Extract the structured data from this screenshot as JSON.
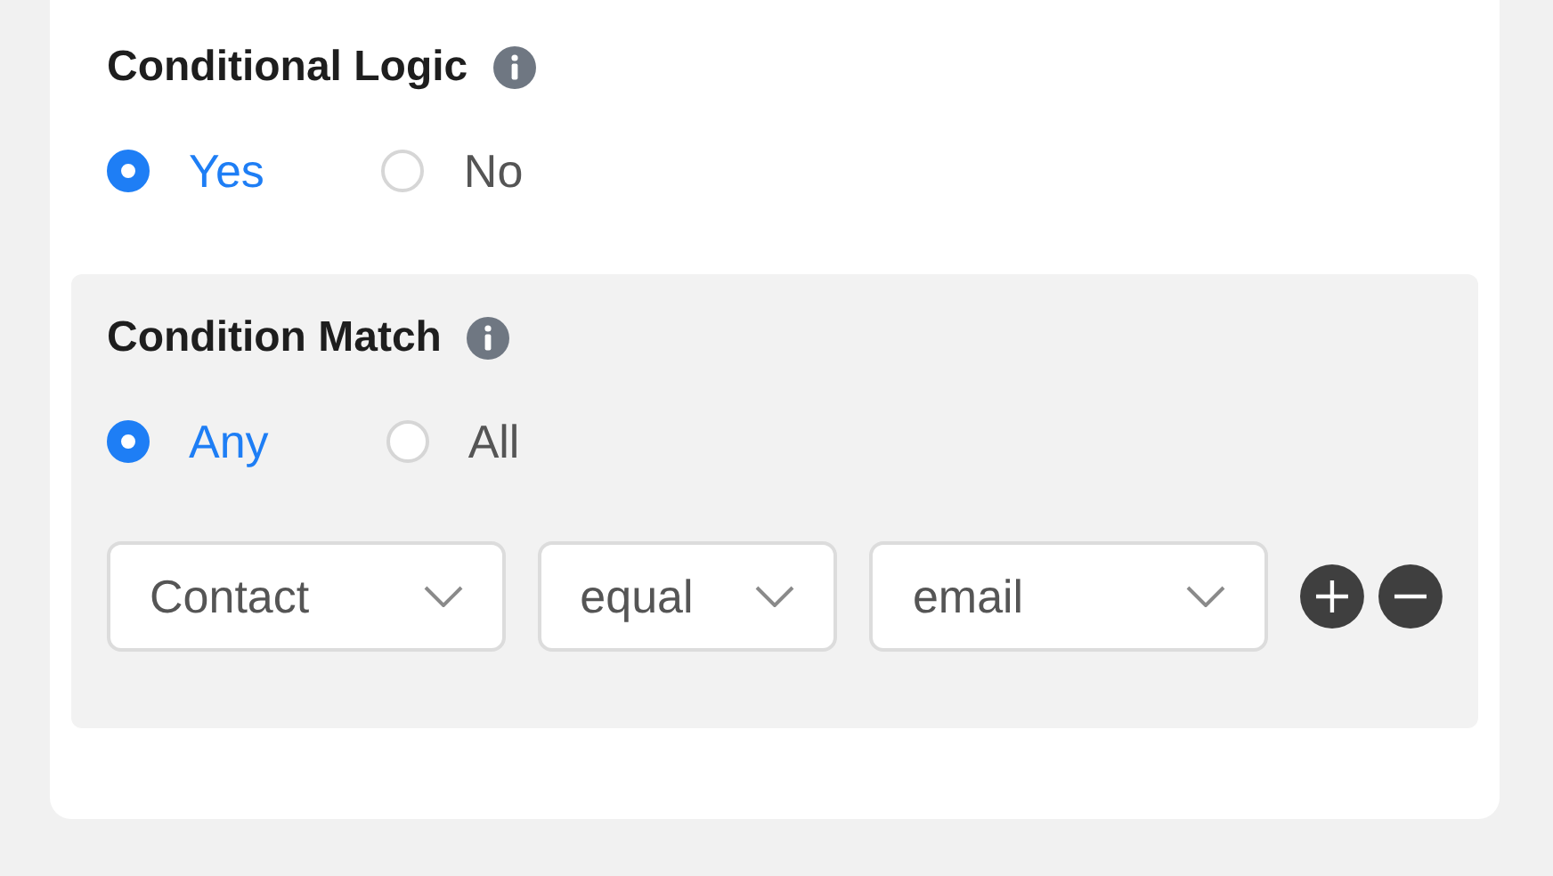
{
  "conditional_logic": {
    "title": "Conditional Logic",
    "options": [
      {
        "label": "Yes",
        "selected": true
      },
      {
        "label": "No",
        "selected": false
      }
    ]
  },
  "condition_match": {
    "title": "Condition Match",
    "options": [
      {
        "label": "Any",
        "selected": true
      },
      {
        "label": "All",
        "selected": false
      }
    ],
    "rule": {
      "fields": [
        {
          "value": "Contact"
        },
        {
          "value": "equal"
        },
        {
          "value": "email"
        }
      ]
    }
  }
}
